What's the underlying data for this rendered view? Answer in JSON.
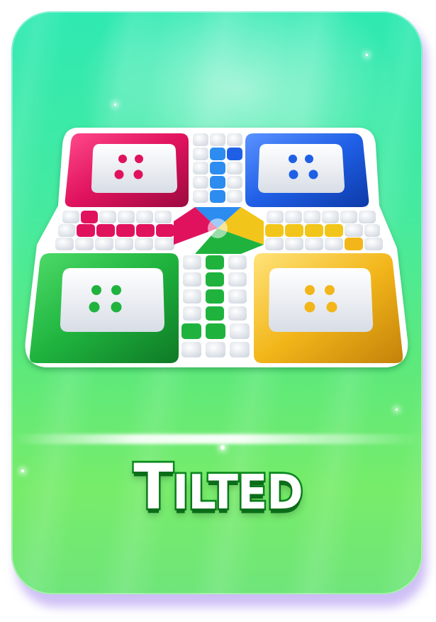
{
  "mode_card": {
    "title_first": "T",
    "title_rest": "ILTED",
    "board_icon": "ludo-board-icon",
    "player_colors": {
      "red": "#e0125e",
      "blue": "#1f5fe6",
      "green": "#1fb33e",
      "yellow": "#f2b61a"
    },
    "background_color": "#46ea9f",
    "title_outline_color": "#0c8a1f"
  }
}
